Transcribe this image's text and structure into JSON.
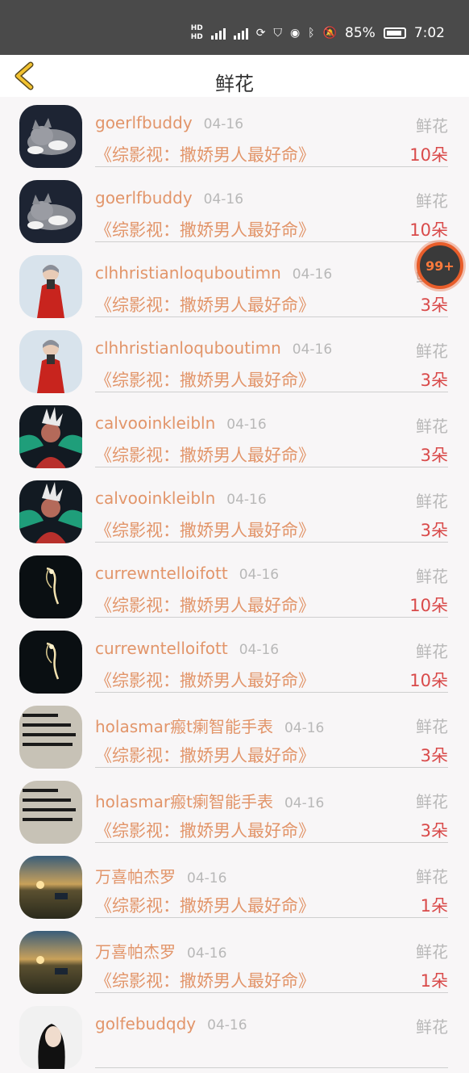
{
  "status_bar": {
    "battery": "85%",
    "time": "7:02",
    "network": "4G"
  },
  "header": {
    "title": "鲜花"
  },
  "floating_badge": "99+",
  "items": [
    {
      "name": "goerlfbuddy",
      "date": "04-16",
      "gift": "鲜花",
      "work": "《综影视：撒娇男人最好命》",
      "count": "10朵",
      "avatar": "cat"
    },
    {
      "name": "goerlfbuddy",
      "date": "04-16",
      "gift": "鲜花",
      "work": "《综影视：撒娇男人最好命》",
      "count": "10朵",
      "avatar": "cat"
    },
    {
      "name": "clhhristianloquboutimn",
      "date": "04-16",
      "gift": "鲜花",
      "work": "《综影视：撒娇男人最好命》",
      "count": "3朵",
      "avatar": "red-figure"
    },
    {
      "name": "clhhristianloquboutimn",
      "date": "04-16",
      "gift": "鲜花",
      "work": "《综影视：撒娇男人最好命》",
      "count": "3朵",
      "avatar": "red-figure"
    },
    {
      "name": "calvooinkleibln",
      "date": "04-16",
      "gift": "鲜花",
      "work": "《综影视：撒娇男人最好命》",
      "count": "3朵",
      "avatar": "game-character"
    },
    {
      "name": "calvooinkleibln",
      "date": "04-16",
      "gift": "鲜花",
      "work": "《综影视：撒娇男人最好命》",
      "count": "3朵",
      "avatar": "game-character"
    },
    {
      "name": "currewntelloifott",
      "date": "04-16",
      "gift": "鲜花",
      "work": "《综影视：撒娇男人最好命》",
      "count": "10朵",
      "avatar": "dark-glow"
    },
    {
      "name": "currewntelloifott",
      "date": "04-16",
      "gift": "鲜花",
      "work": "《综影视：撒娇男人最好命》",
      "count": "10朵",
      "avatar": "dark-glow"
    },
    {
      "name": "holasmar瘢t瘌智能手表",
      "date": "04-16",
      "gift": "鲜花",
      "work": "《综影视：撒娇男人最好命》",
      "count": "3朵",
      "avatar": "text-card"
    },
    {
      "name": "holasmar瘢t瘌智能手表",
      "date": "04-16",
      "gift": "鲜花",
      "work": "《综影视：撒娇男人最好命》",
      "count": "3朵",
      "avatar": "text-card"
    },
    {
      "name": "万喜帕杰罗",
      "date": "04-16",
      "gift": "鲜花",
      "work": "《综影视：撒娇男人最好命》",
      "count": "1朵",
      "avatar": "sunset"
    },
    {
      "name": "万喜帕杰罗",
      "date": "04-16",
      "gift": "鲜花",
      "work": "《综影视：撒娇男人最好命》",
      "count": "1朵",
      "avatar": "sunset"
    },
    {
      "name": "golfebudqdy",
      "date": "04-16",
      "gift": "鲜花",
      "work": "",
      "count": "",
      "avatar": "portrait"
    }
  ],
  "colors": {
    "accent": "#e2956a",
    "count": "#d94a4a",
    "muted": "#b8b8b8",
    "status_bg": "#4a4a4a"
  }
}
